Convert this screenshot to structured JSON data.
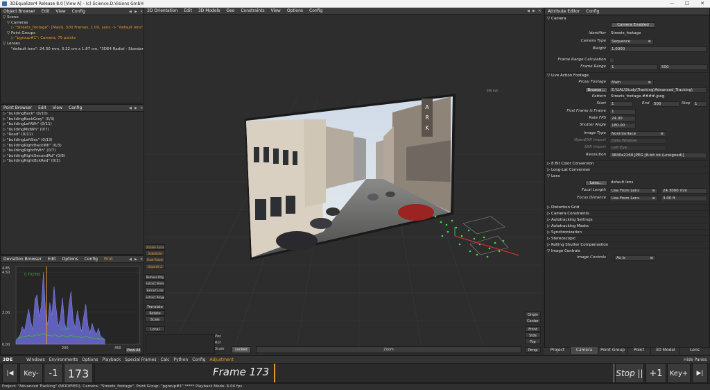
{
  "window": {
    "title": "3DEqualizer4 Release 8.0 [View A] - (c) Science.D.Visions GmbH",
    "min": "—",
    "max": "☐",
    "close": "✕"
  },
  "object_browser": {
    "menu": [
      "Object Browser",
      "Edit",
      "View",
      "Config"
    ],
    "items": [
      {
        "text": "▽ Scene",
        "style": "normal"
      },
      {
        "text": "▽ Cameras",
        "style": "normal"
      },
      {
        "text": "▷ \"Streets_footage\": [Main], 500 Frames, 1.00, Lens -> \"default lens\"",
        "style": "orange"
      },
      {
        "text": "▽ Point Groups",
        "style": "normal"
      },
      {
        "text": "▷ \"pgroup#1\": Camera, 75 points",
        "style": "orange"
      },
      {
        "text": "▽ Lenses",
        "style": "normal"
      },
      {
        "text": "\"default lens\": 24.30 mm, 3.32 cm x 1.87 cm, \"3DE4 Radial - Standard, D",
        "style": "normal"
      }
    ]
  },
  "point_browser": {
    "menu": [
      "Point Browser",
      "Edit",
      "View",
      "Config"
    ],
    "items": [
      "▷ \"buildingBack\" (0/10)",
      "▷ \"buildingBackGray\" (0/3)",
      "▷ \"buildingLeftWh\" (0/11)",
      "▷ \"buildingMidWh\" (0/7)",
      "▷ \"Road\" (0/11)",
      "▷ \"buildingLeftSec\" (0/13)",
      "▷ \"buildingRightBackWh\" (0/3)",
      "▷ \"buildingRightFrWh\" (0/7)",
      "▷ \"buildingRightSecondRd\" (0/8)",
      "▷ \"buildingRightBckRed\" (0/2)"
    ]
  },
  "deviation_browser": {
    "menu": [
      "Deviation Browser",
      "Edit",
      "Options",
      "Config",
      "Find"
    ],
    "y_top": "4.85",
    "y_labels": [
      "4.50",
      "2.00",
      "0.00"
    ],
    "peak_label": "0.702591",
    "avg_label": "0.4418",
    "x_labels": [
      "200",
      "450"
    ],
    "view_all": "View All",
    "chart_data": {
      "type": "area",
      "title": "",
      "xlabel": "",
      "ylabel": "",
      "ylim": [
        0,
        4.85
      ],
      "xlim": [
        0,
        500
      ],
      "current_frame": 173,
      "series": [
        {
          "values": [
            0.2,
            0.4,
            0.6,
            1.1,
            0.8,
            1.5,
            2.2,
            1.4,
            0.9,
            2.8,
            3.1,
            1.7,
            2.4,
            4.5,
            2.0,
            1.2,
            2.6,
            1.8,
            3.6,
            2.2,
            1.1,
            1.6,
            2.9,
            1.3,
            0.9,
            2.4,
            3.3,
            1.6,
            1.0,
            2.1,
            1.4,
            0.8,
            1.7,
            2.5,
            1.2,
            0.7,
            1.3,
            0.9,
            0.6,
            1.0,
            0.5,
            0.4,
            0.3
          ]
        },
        {
          "values": [
            0.3,
            0.35,
            0.4,
            0.45,
            0.5,
            0.5,
            0.55,
            0.5,
            0.5,
            0.55,
            0.6,
            0.55,
            0.6,
            0.7,
            0.6,
            0.55,
            0.55,
            0.5,
            0.6,
            0.55,
            0.5,
            0.5,
            0.55,
            0.5,
            0.45,
            0.5,
            0.55,
            0.5,
            0.45,
            0.5,
            0.45,
            0.4,
            0.45,
            0.5,
            0.45,
            0.4,
            0.4,
            0.35,
            0.35,
            0.35,
            0.3,
            0.3,
            0.3
          ]
        }
      ]
    }
  },
  "orientation": {
    "menu": [
      "3D Orientation",
      "Edit",
      "3D Models",
      "Geo",
      "Constraints",
      "View",
      "Options",
      "Config"
    ],
    "tools_left": [
      {
        "label": "Disable Survey",
        "orange": true
      },
      {
        "label": "Subdivide",
        "orange": true
      },
      {
        "label": "Push Points",
        "orange": true
      },
      {
        "label": "Object% 2",
        "orange": true
      },
      {
        "label": "Remove Poly",
        "orange": false
      },
      {
        "label": "Extract Verse",
        "orange": false
      },
      {
        "label": "Extract Line",
        "orange": false
      },
      {
        "label": "Extract Polygon",
        "orange": false
      }
    ],
    "transform": [
      "Translate",
      "Rotate",
      "Scale"
    ],
    "local": "Local",
    "pos_labels": [
      "Pos",
      "Rot",
      "Scale"
    ],
    "locked": "Locked",
    "zoom": "Zoom",
    "views_right": [
      "Origin",
      "Center",
      "Front",
      "Side",
      "Top"
    ],
    "persp": "Persp",
    "tiny_label": "200 mm",
    "sign_letters": [
      "A",
      "R",
      "K"
    ]
  },
  "attribute_editor": {
    "menu": [
      "Attribute Editor",
      "Config"
    ],
    "camera_header": "▽ Camera",
    "camera_enabled": "Camera Enabled",
    "rows_camera": [
      {
        "label": "Identifier",
        "value": "Streets_footage"
      },
      {
        "label": "Camera Type",
        "value": "Sequence",
        "dropdown": true
      },
      {
        "label": "Weight",
        "value": "1.0000"
      }
    ],
    "frame_range_calc": "Frame Range Calculation",
    "frame_range": {
      "label": "Frame Range",
      "from": "1",
      "to": "500"
    },
    "live_action_header": "▽ Live Action Footage",
    "proxy": {
      "label": "Proxy Footage",
      "value": "Main"
    },
    "browse": "Browse...",
    "path": "E:\\UAL\\Study\\Tracking\\Advanced_Tracking\\",
    "pattern": {
      "label": "Pattern",
      "value": "Streets_footage.####.jpeg"
    },
    "start": {
      "label": "Start",
      "value": "1"
    },
    "end": {
      "label": "End",
      "value": "500"
    },
    "step": {
      "label": "Step",
      "value": "1"
    },
    "first_frame": {
      "label": "First Frame is Frame",
      "value": "1"
    },
    "rate": {
      "label": "Rate FPS",
      "value": "24.00"
    },
    "shutter": {
      "label": "Shutter Angle",
      "value": "180.00"
    },
    "image_type": {
      "label": "Image Type",
      "value": "Noninterlace"
    },
    "openexr": {
      "label": "OpenEXR Import",
      "value": "Data Window"
    },
    "sxr": {
      "label": "SXR Import",
      "value": "Left Eye"
    },
    "resolution": {
      "label": "Resolution",
      "value": "3840x2160 JPEG [8-bit int (unsigned)]"
    },
    "sections_a": [
      "▷ 8 Bit Color Conversion",
      "▷ Long-Lat Conversion"
    ],
    "lens_header": "▽ Lens",
    "lens_btn": "Lens...",
    "lens_name": "default lens",
    "focal": {
      "label": "Focal Length",
      "mode": "Use From Lens",
      "value": "24.3000 mm"
    },
    "focus": {
      "label": "Focus Distance",
      "mode": "Use From Lens",
      "value": "3.00 ft"
    },
    "sections_b": [
      "▷ Distortion Grid",
      "▷ Camera Constraints",
      "▷ Autotracking Settings",
      "▷ Autotracking Masks",
      "▷ Synchronization",
      "▷ Stereoscopic",
      "▷ Rolling Shutter Compensation"
    ],
    "image_controls_header": "▽ Image Controls",
    "image_controls": {
      "label": "Image Controls",
      "value": "As Is"
    },
    "tabs": [
      "Project",
      "Camera",
      "Point Group",
      "Point",
      "3D Model",
      "Lens"
    ],
    "active_tab": 1
  },
  "bottom_menu": {
    "logo": "3DE",
    "items": [
      "Windows",
      "Environments",
      "Options",
      "Playback",
      "Special Frames",
      "Calc",
      "Python",
      "Config",
      "Adjustment"
    ],
    "hide_panes": "Hide Panes"
  },
  "timeline": {
    "first": "|◀",
    "key_prev": "Key-",
    "minus": "-1",
    "frame_num": "173",
    "frame_label": "Frame 173",
    "stop": "Stop ||",
    "plus": "+1",
    "key_next": "Key+",
    "last": "▶|",
    "current_frame": 173,
    "total_frames": 500
  },
  "status": {
    "text": "Project: \"Advanced Tracking\" (MODIFIED), Camera: \"Streets_footage\", Point Group: \"pgroup#1\" ***** Playback Mode: 6.04 fps"
  },
  "colors": {
    "accent_orange": "#e59a2a",
    "panel_bg": "#2e2e2e",
    "graph_purple": "#6b6bd6",
    "graph_green": "#3cb43c",
    "track_green": "#3fe03f"
  }
}
